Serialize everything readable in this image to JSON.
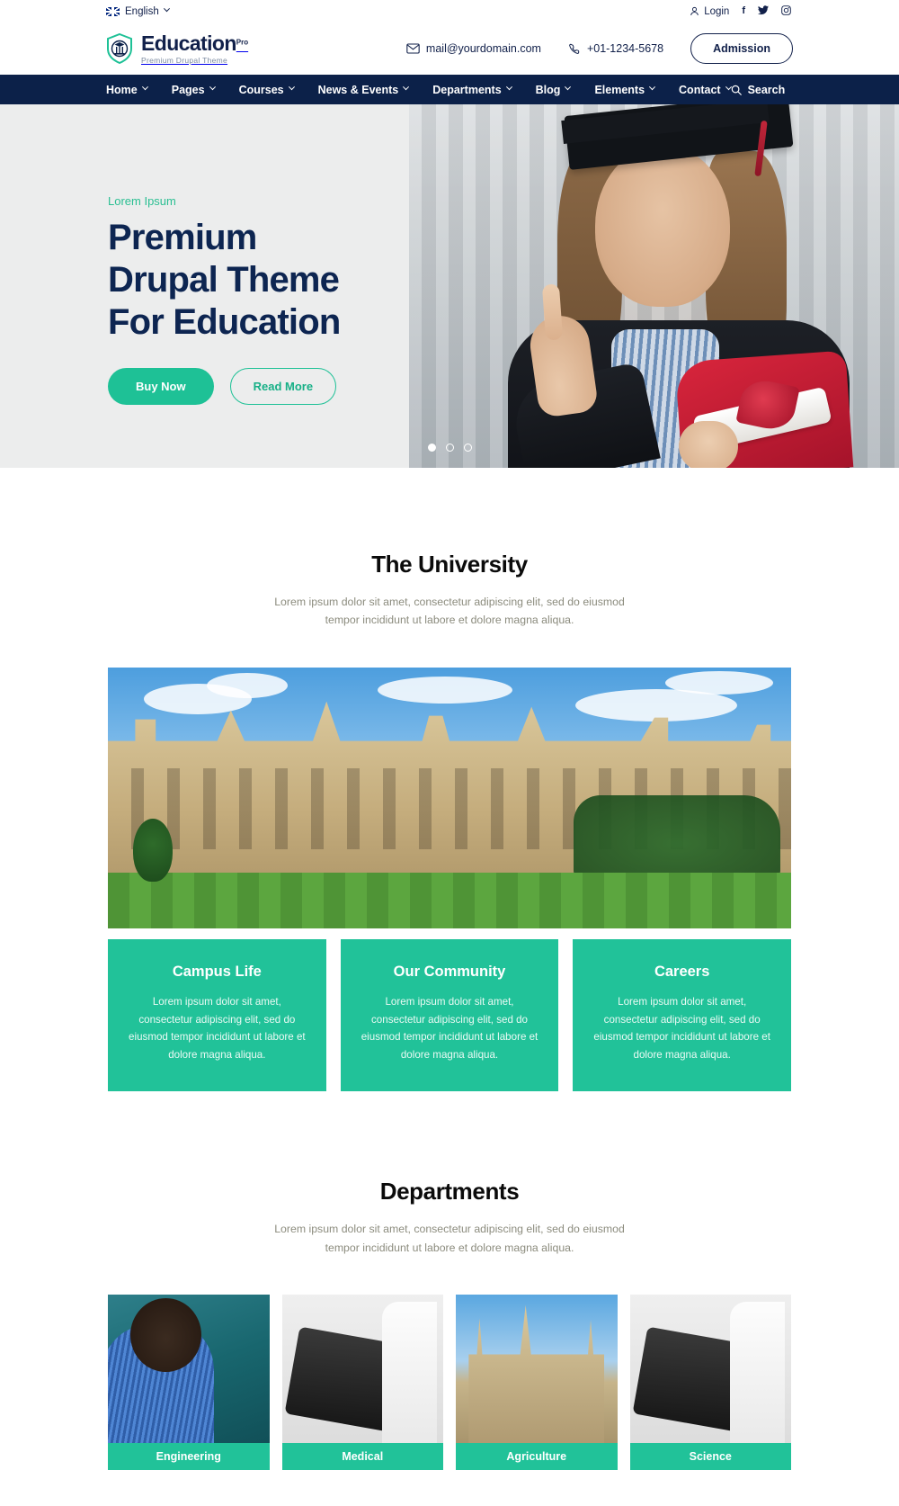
{
  "topbar": {
    "language": "English",
    "language_icon": "uk-flag-icon",
    "chevron_icon": "chevron-down-icon",
    "login_label": "Login",
    "login_icon": "user-icon",
    "socials": [
      {
        "name": "facebook-icon",
        "glyph": "f"
      },
      {
        "name": "twitter-icon",
        "glyph": "✈"
      },
      {
        "name": "instagram-icon",
        "glyph": "▣"
      }
    ]
  },
  "header": {
    "logo_icon": "shield-graduation-logo",
    "brand_name": "Education",
    "brand_sup": "Pro",
    "brand_tagline": "Premium Drupal Theme",
    "email_icon": "envelope-icon",
    "email": "mail@yourdomain.com",
    "phone_icon": "phone-icon",
    "phone": "+01-1234-5678",
    "admission_label": "Admission"
  },
  "nav": {
    "items": [
      {
        "label": "Home",
        "has_caret": true
      },
      {
        "label": "Pages",
        "has_caret": true
      },
      {
        "label": "Courses",
        "has_caret": true
      },
      {
        "label": "News & Events",
        "has_caret": true
      },
      {
        "label": "Departments",
        "has_caret": true
      },
      {
        "label": "Blog",
        "has_caret": true
      },
      {
        "label": "Elements",
        "has_caret": true
      },
      {
        "label": "Contact",
        "has_caret": true
      }
    ],
    "search_label": "Search",
    "search_icon": "search-icon"
  },
  "hero": {
    "eyebrow": "Lorem Ipsum",
    "title_line1": "Premium",
    "title_line2": "Drupal Theme",
    "title_line3": "For Education",
    "primary_button": "Buy Now",
    "secondary_button": "Read More",
    "slide_count": 3,
    "active_slide": 1,
    "accent_color": "#1ec196",
    "heading_color": "#0d2551"
  },
  "university": {
    "title": "The University",
    "subtitle": "Lorem ipsum dolor sit amet, consectetur adipiscing elit, sed do eiusmod tempor incididunt ut labore et dolore magna aliqua.",
    "image_alt": "campus-building-photo",
    "cards": [
      {
        "title": "Campus Life",
        "body": "Lorem ipsum dolor sit amet, consectetur adipiscing elit, sed do eiusmod tempor incididunt ut labore et dolore magna aliqua."
      },
      {
        "title": "Our Community",
        "body": "Lorem ipsum dolor sit amet, consectetur adipiscing elit, sed do eiusmod tempor incididunt ut labore et dolore magna aliqua."
      },
      {
        "title": "Careers",
        "body": "Lorem ipsum dolor sit amet, consectetur adipiscing elit, sed do eiusmod tempor incididunt ut labore et dolore magna aliqua."
      }
    ],
    "card_color": "#21c299"
  },
  "departments": {
    "title": "Departments",
    "subtitle": "Lorem ipsum dolor sit amet, consectetur adipiscing elit, sed do eiusmod tempor incididunt ut labore et dolore magna aliqua.",
    "items": [
      {
        "label": "Engineering",
        "image_alt": "teacher-at-blackboard-photo"
      },
      {
        "label": "Medical",
        "image_alt": "microscope-photo"
      },
      {
        "label": "Agriculture",
        "image_alt": "campus-building-photo"
      },
      {
        "label": "Science",
        "image_alt": "microscope-photo"
      }
    ]
  }
}
